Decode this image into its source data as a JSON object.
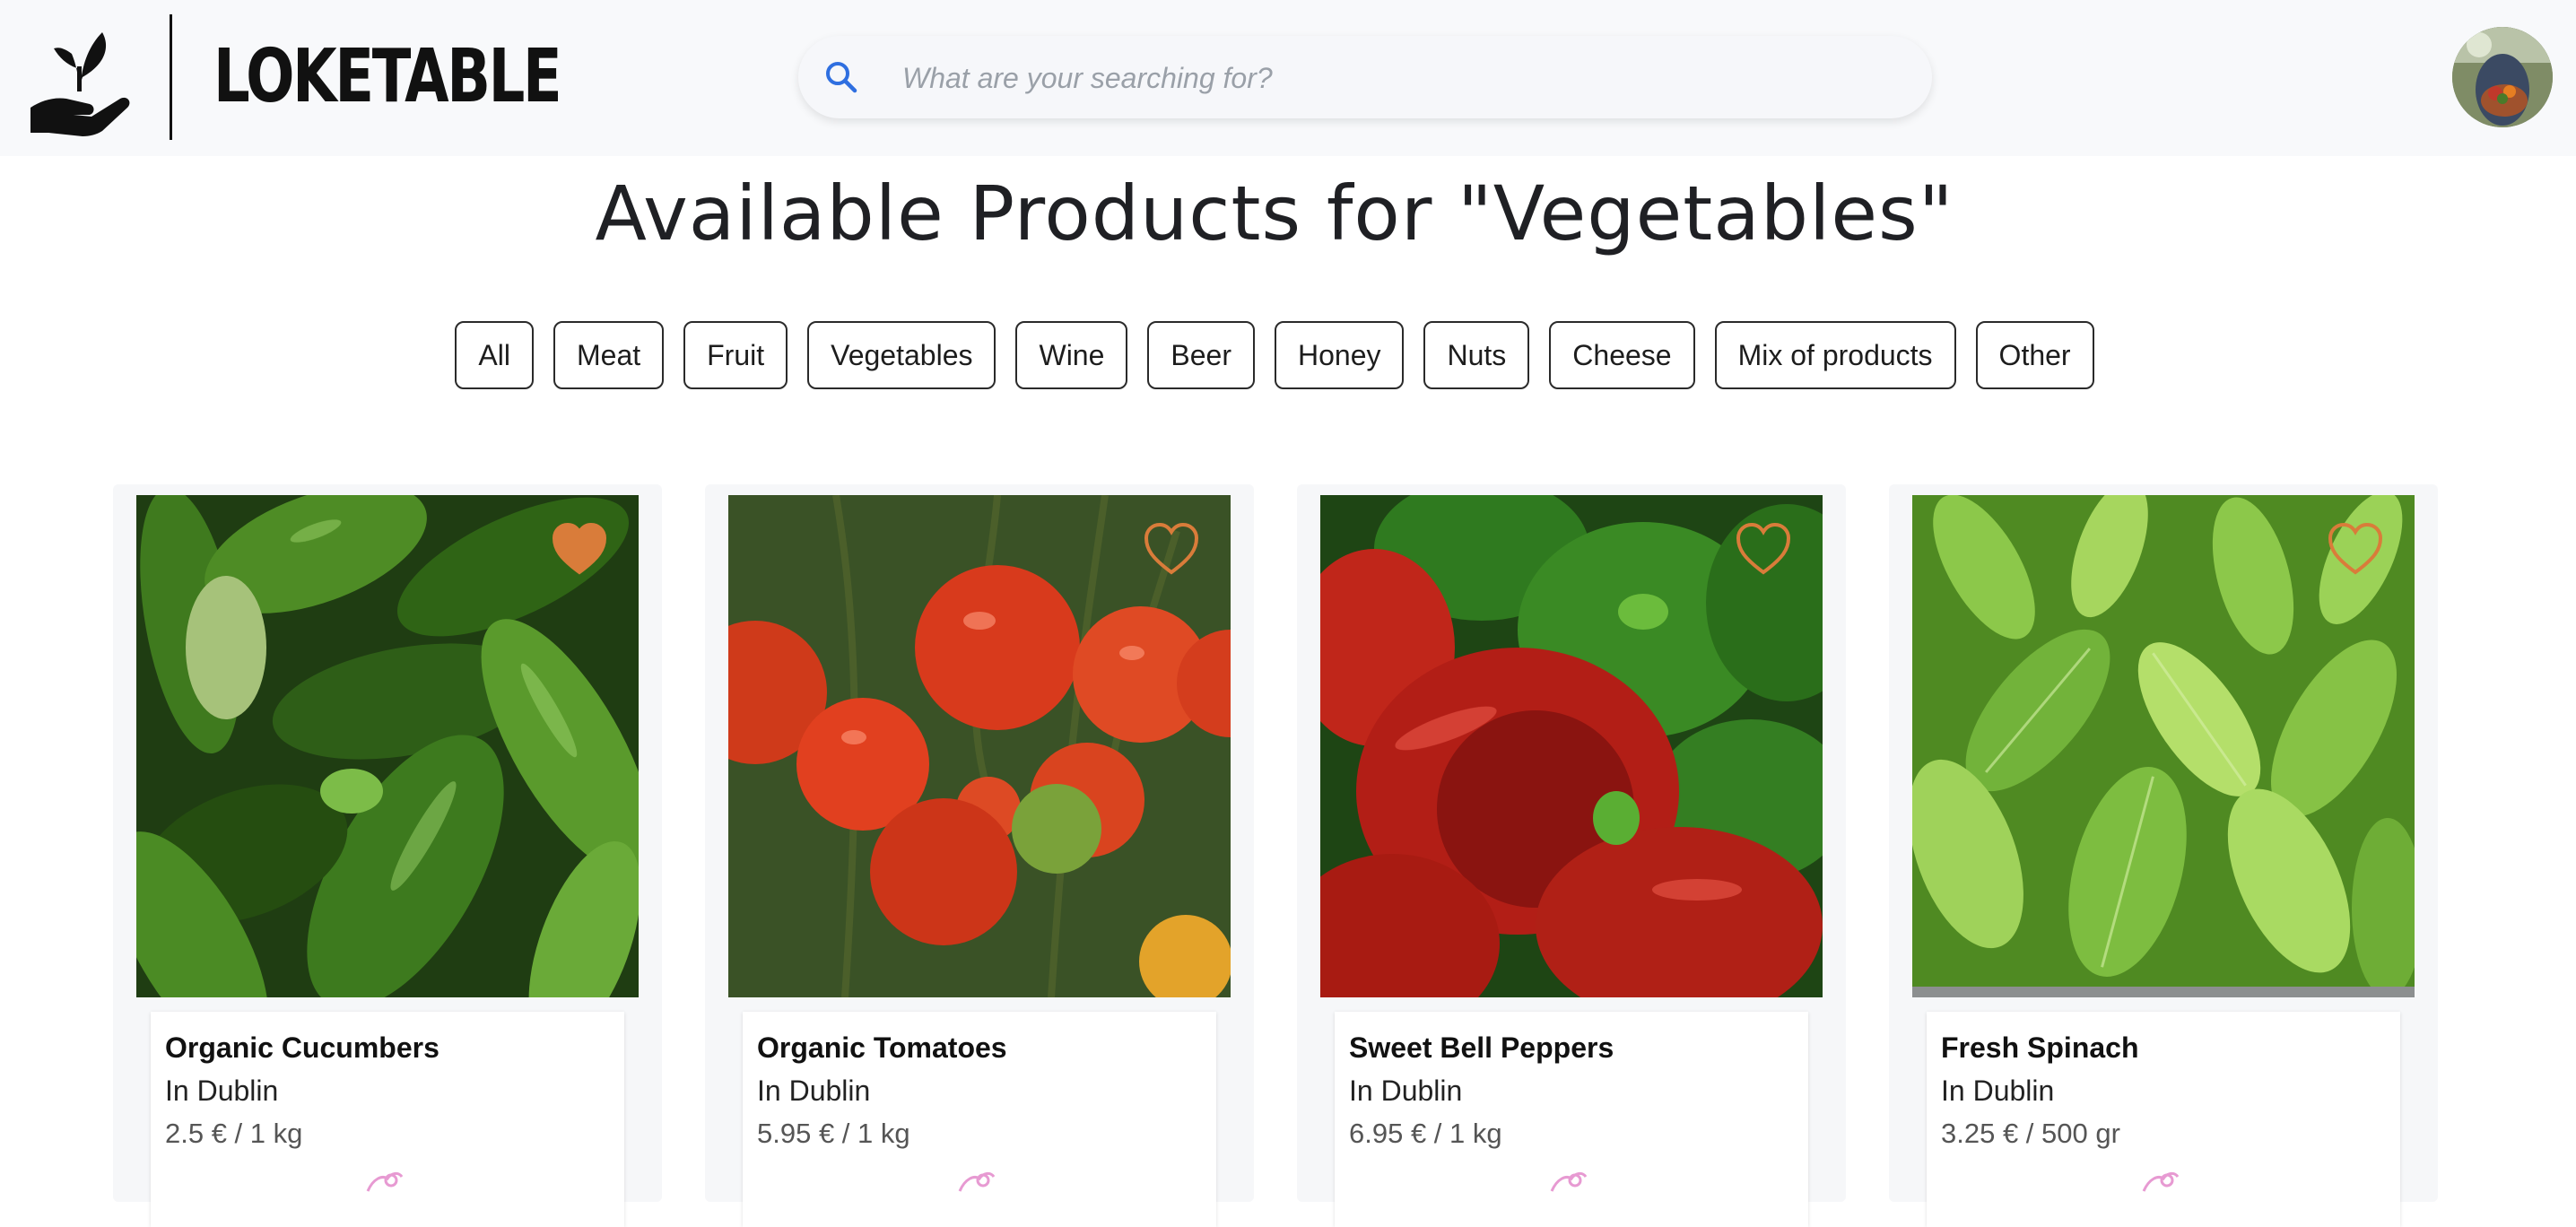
{
  "brand": {
    "name": "LOKETABLE"
  },
  "search": {
    "placeholder": "What are your searching for?",
    "value": ""
  },
  "page": {
    "title": "Available Products for \"Vegetables\""
  },
  "filters": [
    {
      "label": "All"
    },
    {
      "label": "Meat"
    },
    {
      "label": "Fruit"
    },
    {
      "label": "Vegetables"
    },
    {
      "label": "Wine"
    },
    {
      "label": "Beer"
    },
    {
      "label": "Honey"
    },
    {
      "label": "Nuts"
    },
    {
      "label": "Cheese"
    },
    {
      "label": "Mix of products"
    },
    {
      "label": "Other"
    }
  ],
  "products": [
    {
      "name": "Organic Cucumbers",
      "location": "In Dublin",
      "price": "2.5 € / 1 kg",
      "favorite": true,
      "image_icon": "cucumbers-photo"
    },
    {
      "name": "Organic Tomatoes",
      "location": "In Dublin",
      "price": "5.95 € / 1 kg",
      "favorite": false,
      "image_icon": "tomatoes-photo"
    },
    {
      "name": "Sweet Bell Peppers",
      "location": "In Dublin",
      "price": "6.95 € / 1 kg",
      "favorite": false,
      "image_icon": "peppers-photo"
    },
    {
      "name": "Fresh Spinach",
      "location": "In Dublin",
      "price": "3.25 € / 500 gr",
      "favorite": false,
      "image_icon": "spinach-photo"
    }
  ],
  "colors": {
    "accent_heart": "#d97c3a",
    "search_icon": "#2f6fe0",
    "header_bg": "#f8f9fb"
  }
}
